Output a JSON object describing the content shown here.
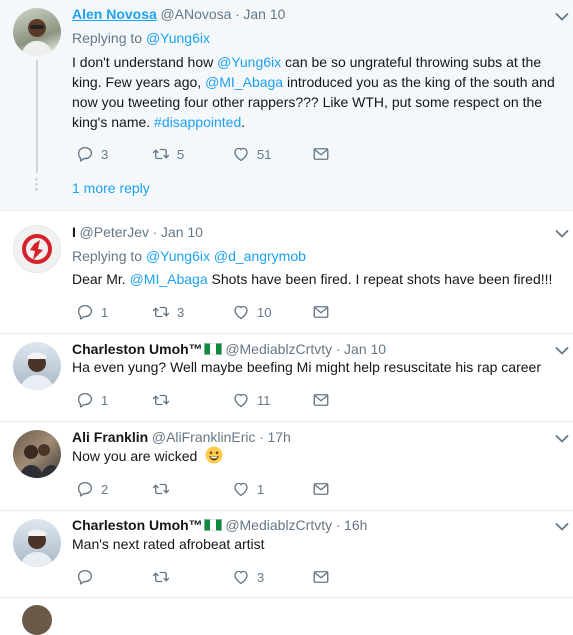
{
  "tweets": [
    {
      "name": "Alen Novosa",
      "handle": "@ANovosa",
      "time": "Jan 10",
      "replying_label": "Replying to",
      "replying_to": "@Yung6ix",
      "text_parts": {
        "p1": "I don't understand how ",
        "m1": "@Yung6ix",
        "p2": " can be so ungrateful throwing subs at the king. Few years ago, ",
        "m2": "@MI_Abaga",
        "p3": " introduced you as the king of the south and now you tweeting four other rappers??? Like WTH, put some respect on the king's name. ",
        "h1": "#disappointed",
        "p4": "."
      },
      "replies": "3",
      "retweets": "5",
      "likes": "51",
      "more_replies": "1 more reply"
    },
    {
      "name": "I",
      "handle": "@PeterJev",
      "time": "Jan 10",
      "replying_label": "Replying to",
      "replying_to": "@Yung6ix",
      "replying_to_2": "@d_angrymob",
      "text_parts": {
        "p1": "Dear Mr. ",
        "m1": "@MI_Abaga",
        "p2": " Shots have been fired. I repeat shots have been fired!!!"
      },
      "replies": "1",
      "retweets": "3",
      "likes": "10"
    },
    {
      "name": "Charleston Umoh™",
      "handle": "@MediablzCrtvty",
      "time": "Jan 10",
      "text": "Ha even yung? Well maybe beefing Mi might help resuscitate his rap career",
      "replies": "1",
      "retweets": "",
      "likes": "11"
    },
    {
      "name": "Ali Franklin",
      "handle": "@AliFranklinEric",
      "time": "17h",
      "text": "Now you are wicked",
      "replies": "2",
      "retweets": "",
      "likes": "1"
    },
    {
      "name": "Charleston Umoh™",
      "handle": "@MediablzCrtvty",
      "time": "16h",
      "text": "Man's next rated afrobeat artist",
      "replies": "",
      "retweets": "",
      "likes": "3"
    }
  ],
  "dot": "·",
  "icons": [
    "reply-icon",
    "retweet-icon",
    "like-icon",
    "message-icon",
    "chevron-down-icon",
    "nigeria-flag-icon",
    "smiley-emoji-icon"
  ],
  "colors": {
    "link": "#1da1f2",
    "muted": "#657786",
    "text": "#14171a",
    "border": "#e6ecf0"
  }
}
